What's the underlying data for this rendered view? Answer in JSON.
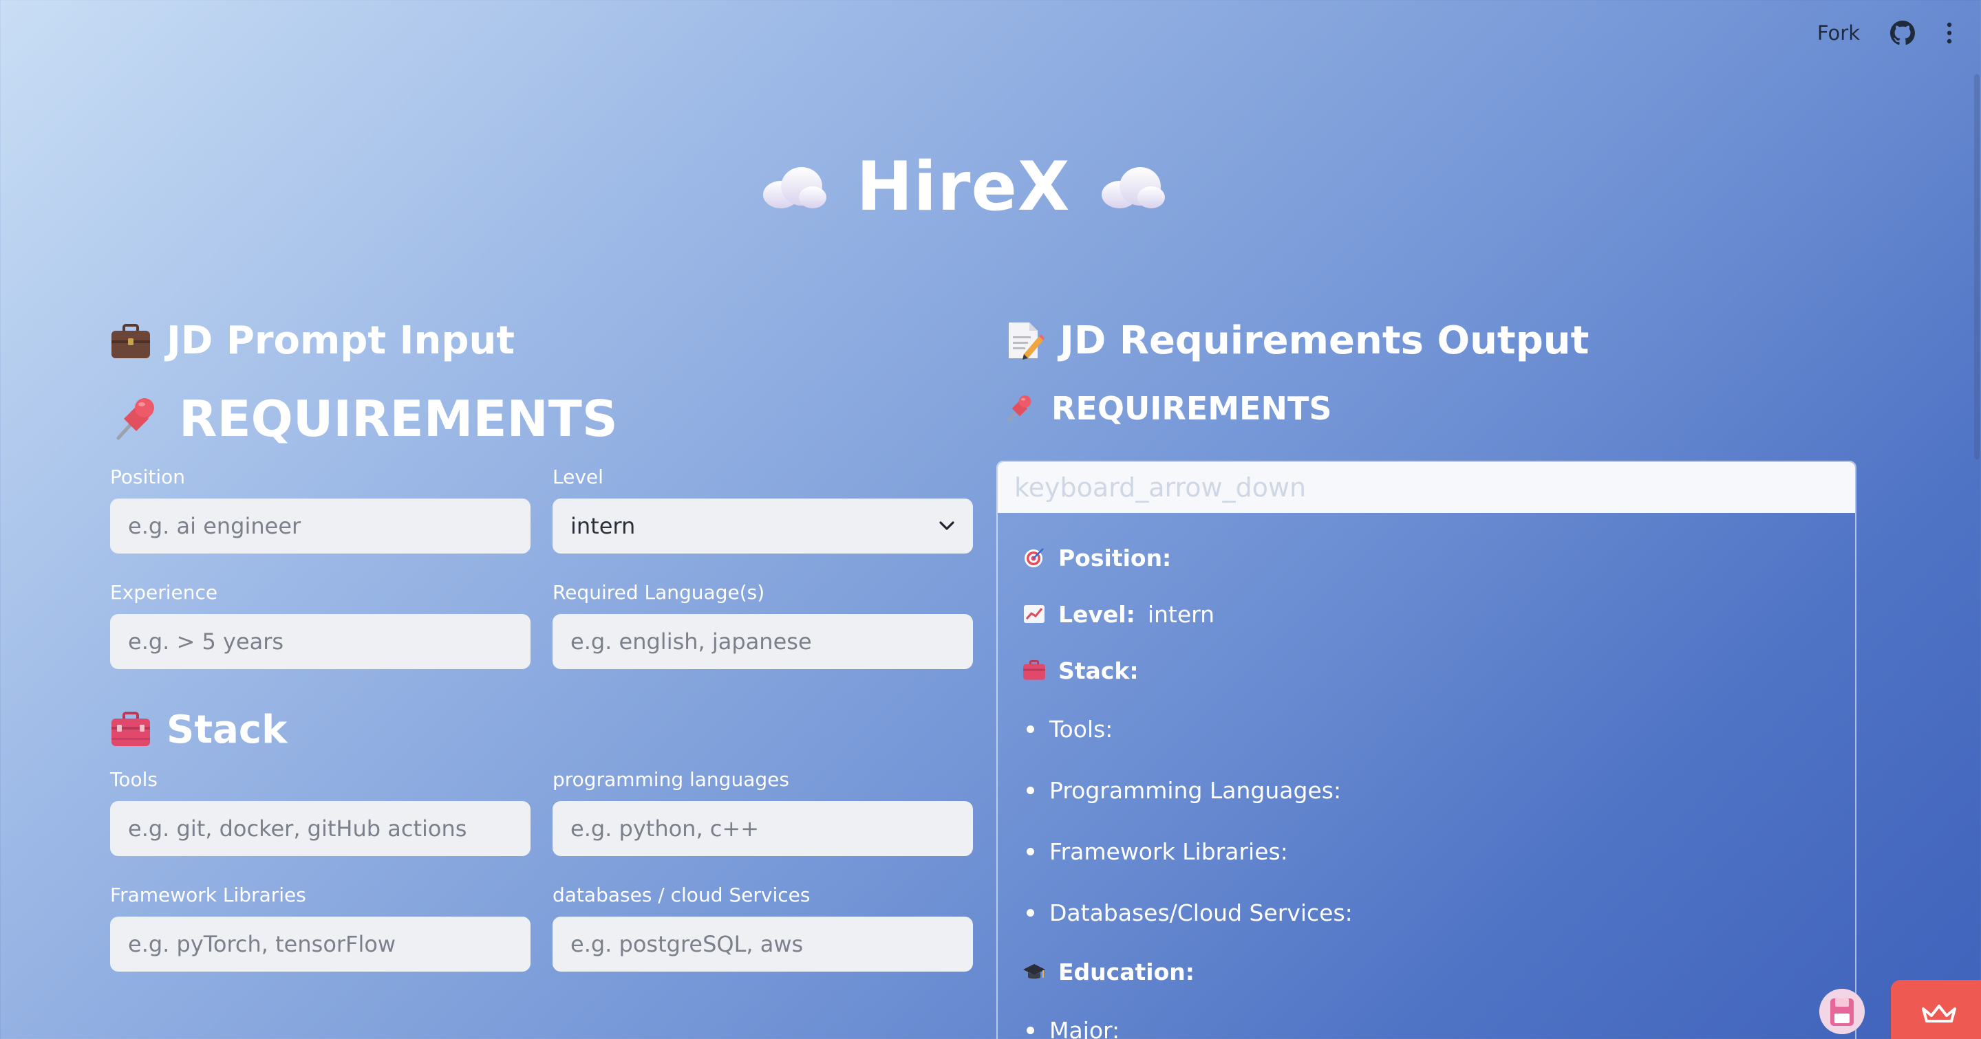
{
  "topbar": {
    "fork_label": "Fork",
    "github_icon": "github-icon",
    "menu_icon": "kebab-menu-icon"
  },
  "hero": {
    "title": "HireX",
    "left_icon": "cloud-icon",
    "right_icon": "cloud-icon"
  },
  "input_panel": {
    "heading": "JD Prompt Input",
    "heading_icon": "briefcase-icon",
    "requirements": {
      "heading": "REQUIREMENTS",
      "heading_icon": "pushpin-icon",
      "position": {
        "label": "Position",
        "placeholder": "e.g. ai engineer",
        "value": ""
      },
      "level": {
        "label": "Level",
        "value": "intern"
      },
      "experience": {
        "label": "Experience",
        "placeholder": "e.g. > 5 years",
        "value": ""
      },
      "languages": {
        "label": "Required Language(s)",
        "placeholder": "e.g. english, japanese",
        "value": ""
      }
    },
    "stack": {
      "heading": "Stack",
      "heading_icon": "toolbox-icon",
      "tools": {
        "label": "Tools",
        "placeholder": "e.g. git, docker, gitHub actions",
        "value": ""
      },
      "programming": {
        "label": "programming languages",
        "placeholder": "e.g. python, c++",
        "value": ""
      },
      "frameworks": {
        "label": "Framework Libraries",
        "placeholder": "e.g. pyTorch, tensorFlow",
        "value": ""
      },
      "databases": {
        "label": "databases / cloud Services",
        "placeholder": "e.g. postgreSQL, aws",
        "value": ""
      }
    }
  },
  "output_panel": {
    "heading": "JD Requirements Output",
    "heading_icon": "memo-icon",
    "requirements_heading": "REQUIREMENTS",
    "requirements_icon": "pushpin-icon",
    "expander_text": "keyboard_arrow_down",
    "position_label": "Position:",
    "position_value": "",
    "level_label": "Level:",
    "level_value": "intern",
    "stack_label": "Stack:",
    "stack_items": [
      "Tools:",
      "Programming Languages:",
      "Framework Libraries:",
      "Databases/Cloud Services:"
    ],
    "education_label": "Education:",
    "education_items": [
      "Major:"
    ]
  },
  "colors": {
    "gradient_start": "#c9def5",
    "gradient_end": "#3f62bb",
    "input_bg": "#eef0f4",
    "badge": "#ee5a52"
  }
}
